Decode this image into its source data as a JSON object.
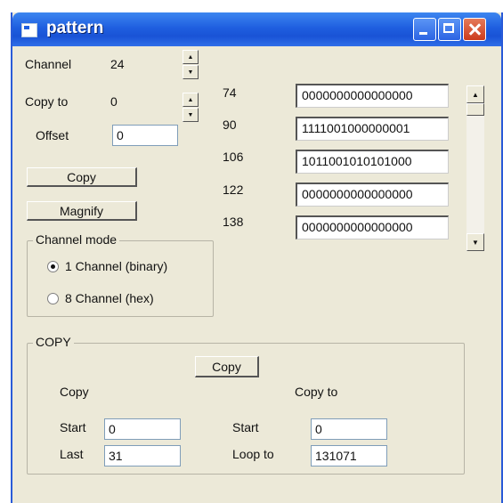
{
  "window": {
    "title": "pattern"
  },
  "channel": {
    "label": "Channel",
    "value": "24"
  },
  "copy_to": {
    "label": "Copy to",
    "value": "0"
  },
  "offset": {
    "label": "Offset",
    "value": "0"
  },
  "buttons": {
    "copy": "Copy",
    "magnify": "Magnify",
    "copy2": "Copy"
  },
  "channel_mode": {
    "label": "Channel mode",
    "options": [
      "1 Channel (binary)",
      "8 Channel (hex)"
    ],
    "selected": "1 Channel (binary)"
  },
  "pattern_rows": [
    {
      "address": "74",
      "bits": "0000000000000000"
    },
    {
      "address": "90",
      "bits": "1111001000000001"
    },
    {
      "address": "106",
      "bits": "1011001010101000"
    },
    {
      "address": "122",
      "bits": "0000000000000000"
    },
    {
      "address": "138",
      "bits": "0000000000000000"
    }
  ],
  "copy_group": {
    "label": "COPY",
    "copy_col": "Copy",
    "copyto_col": "Copy to",
    "start_label": "Start",
    "last_label": "Last",
    "start_value": "0",
    "last_value": "31",
    "to_start_label": "Start",
    "loop_label": "Loop to",
    "to_start_value": "0",
    "loop_value": "131071"
  },
  "icons": [
    "window-icon",
    "minimize-icon",
    "maximize-icon",
    "close-icon",
    "arrow-up-icon",
    "arrow-down-icon"
  ]
}
